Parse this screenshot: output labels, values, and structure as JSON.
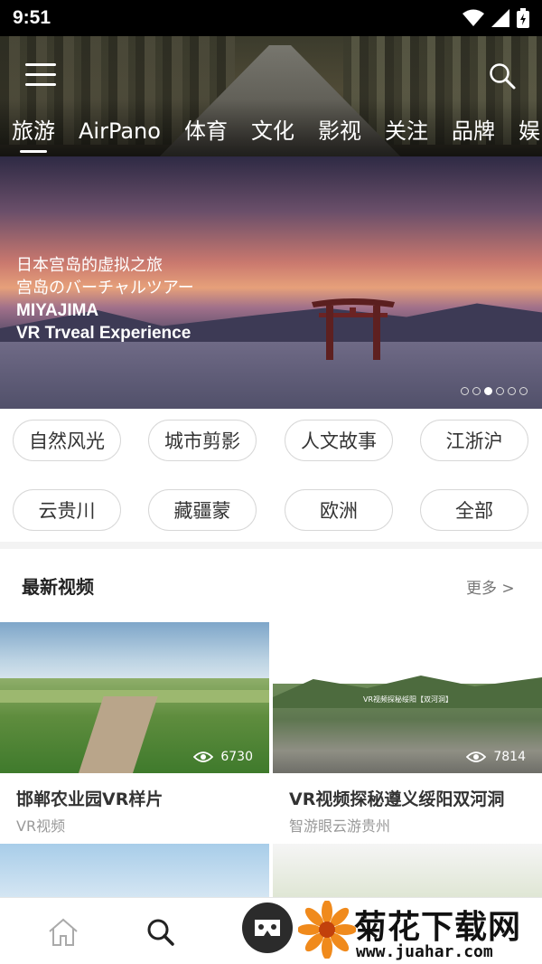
{
  "status_bar": {
    "time": "9:51"
  },
  "header": {
    "tabs": [
      {
        "label": "旅游",
        "active": true
      },
      {
        "label": "AirPano",
        "active": false
      },
      {
        "label": "体育",
        "active": false
      },
      {
        "label": "文化",
        "active": false
      },
      {
        "label": "影视",
        "active": false
      },
      {
        "label": "关注",
        "active": false
      },
      {
        "label": "品牌",
        "active": false
      },
      {
        "label": "娱",
        "active": false
      }
    ]
  },
  "banner": {
    "lines": [
      "日本宫岛的虚拟之旅",
      "宫岛のバーチャルツアー",
      "MIYAJIMA",
      "VR Trveal Experience"
    ],
    "slide_count": 6,
    "active_slide": 3
  },
  "categories": [
    "自然风光",
    "城市剪影",
    "人文故事",
    "江浙沪",
    "云贵川",
    "藏疆蒙",
    "欧洲",
    "全部"
  ],
  "latest": {
    "title": "最新视频",
    "more": "更多 >",
    "videos": [
      {
        "title": "邯郸农业园VR样片",
        "source": "VR视频",
        "views": "6730"
      },
      {
        "title": "VR视频探秘遵义绥阳双河洞",
        "source": "智游眼云游贵州",
        "views": "7814",
        "thumb_caption": "VR视频探秘绥阳【双河洞】"
      }
    ]
  },
  "watermark": {
    "title": "菊花下载网",
    "url": "www.juahar.com"
  },
  "colors": {
    "accent_text": "#333333",
    "muted_text": "#999999",
    "chip_border": "#d7d7d7"
  }
}
